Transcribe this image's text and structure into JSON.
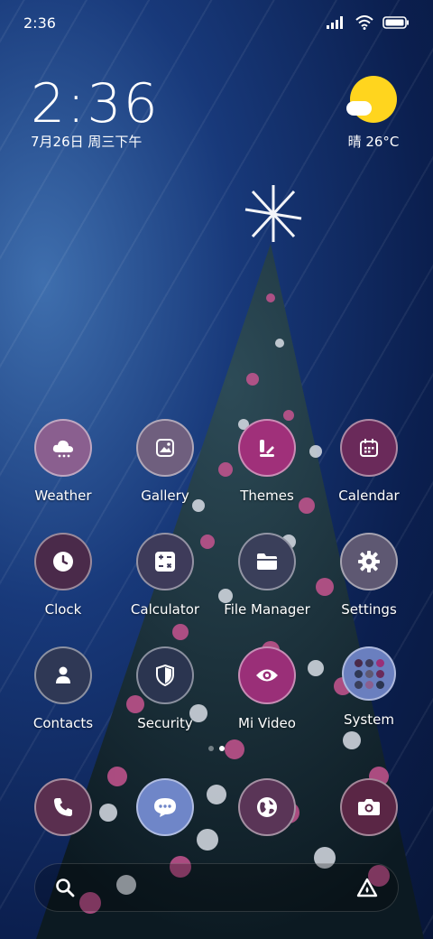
{
  "status": {
    "time": "2:36",
    "signal_icon": "signal-icon",
    "wifi_icon": "wifi-icon",
    "battery_icon": "battery-icon"
  },
  "lock_clock": {
    "time": "2:36",
    "date": "7月26日 周三下午"
  },
  "weather": {
    "text": "晴 26°C",
    "icon": "sun-icon"
  },
  "apps": [
    {
      "label": "Weather",
      "icon": "weather-cloud-icon",
      "color": "#8a5f8f"
    },
    {
      "label": "Gallery",
      "icon": "gallery-icon",
      "color": "#6f5f7e"
    },
    {
      "label": "Themes",
      "icon": "themes-icon",
      "color": "#a0307a"
    },
    {
      "label": "Calendar",
      "icon": "calendar-icon",
      "color": "#6a2a5a"
    },
    {
      "label": "Clock",
      "icon": "clock-icon",
      "color": "#4a2a4a"
    },
    {
      "label": "Calculator",
      "icon": "calculator-icon",
      "color": "#3e3b5a"
    },
    {
      "label": "File Manager",
      "icon": "folder-icon",
      "color": "#3a3f5a"
    },
    {
      "label": "Settings",
      "icon": "gear-icon",
      "color": "#5e5872"
    },
    {
      "label": "Contacts",
      "icon": "contacts-icon",
      "color": "#2f3855"
    },
    {
      "label": "Security",
      "icon": "shield-icon",
      "color": "#2b3550"
    },
    {
      "label": "Mi Video",
      "icon": "eye-icon",
      "color": "#9a2f78"
    },
    {
      "label": "System",
      "icon": "folder-grid-icon",
      "color": "#6a7fbf"
    }
  ],
  "dock": [
    {
      "icon": "phone-icon",
      "color": "#5a2f4f"
    },
    {
      "icon": "messages-icon",
      "color": "#6f86c8"
    },
    {
      "icon": "browser-icon",
      "color": "#5a3557"
    },
    {
      "icon": "camera-icon",
      "color": "#5a2645"
    }
  ],
  "search": {
    "search_icon": "search-icon",
    "assistant_icon": "assistant-icon"
  }
}
